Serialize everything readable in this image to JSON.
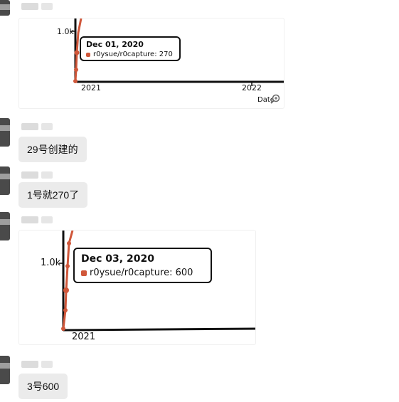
{
  "messages": [
    {
      "type": "image",
      "chart": {
        "ytick": "1.0k",
        "xticks": [
          "2021",
          "2022"
        ],
        "xlabel": "Date",
        "tooltip": {
          "date": "Dec 01, 2020",
          "series": "r0ysue/r0capture",
          "value": "270"
        }
      }
    },
    {
      "type": "text",
      "text": "29号创建的"
    },
    {
      "type": "text",
      "text": "1号就270了"
    },
    {
      "type": "image",
      "chart": {
        "ytick": "1.0k",
        "xticks": [
          "2021"
        ],
        "tooltip": {
          "date": "Dec 03, 2020",
          "series": "r0ysue/r0capture",
          "value": "600"
        }
      }
    },
    {
      "type": "text",
      "text": "3号600"
    }
  ],
  "colors": {
    "line": "#d0573a",
    "bubble": "#ebebeb",
    "axis": "#111111"
  },
  "icons": {
    "zoom": "magnifier-plus-icon"
  }
}
